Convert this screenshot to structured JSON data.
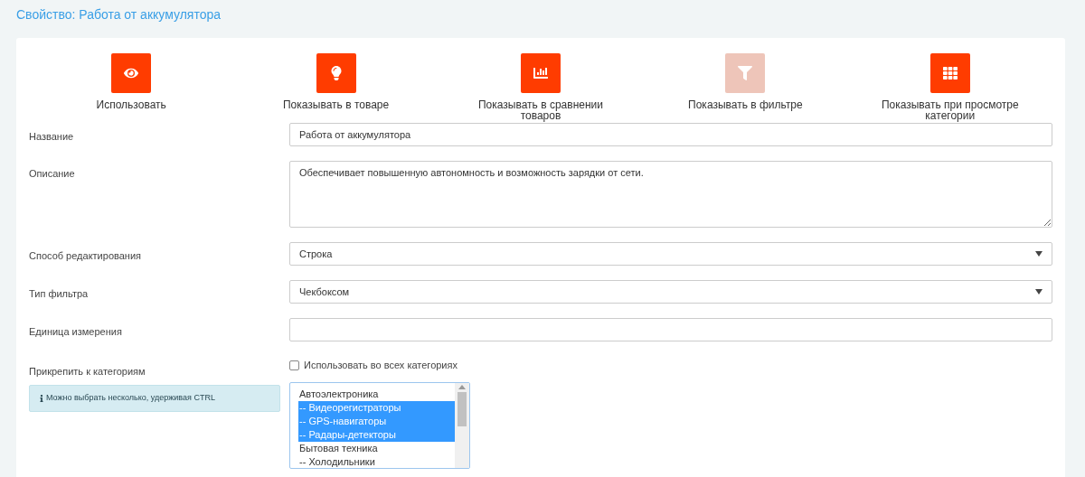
{
  "title": "Свойство: Работа от аккумулятора",
  "toggles": [
    {
      "label": "Использовать",
      "on": true
    },
    {
      "label": "Показывать в товаре",
      "on": true
    },
    {
      "label": "Показывать в сравнении товаров",
      "on": true
    },
    {
      "label": "Показывать в фильтре",
      "on": false
    },
    {
      "label": "Показывать при просмотре категории",
      "on": true
    }
  ],
  "fields": [
    {
      "kind": "input",
      "label": "Название",
      "value": "Работа от аккумулятора"
    },
    {
      "kind": "textarea",
      "label": "Описание",
      "value": "Обеспечивает повышенную автономность и возможность зарядки от сети."
    },
    {
      "kind": "select",
      "label": "Способ редактирования",
      "value": "Строка"
    },
    {
      "kind": "select",
      "label": "Тип фильтра",
      "value": "Чекбоксом"
    },
    {
      "kind": "input",
      "label": "Единица измерения"
    }
  ],
  "categories": {
    "label": "Прикрепить к категориям",
    "all_checkbox": {
      "label": "Использовать во всех категориях",
      "checked": false
    },
    "hint": "Можно выбрать несколько, удерживая CTRL",
    "options": [
      {
        "label": "Автоэлектроника",
        "selected": false
      },
      {
        "label": "-- Видеорегистраторы",
        "selected": true
      },
      {
        "label": "-- GPS-навигаторы",
        "selected": true
      },
      {
        "label": "-- Радары-детекторы",
        "selected": true
      },
      {
        "label": "Бытовая техника",
        "selected": false
      },
      {
        "label": "-- Холодильники",
        "selected": false
      }
    ]
  }
}
